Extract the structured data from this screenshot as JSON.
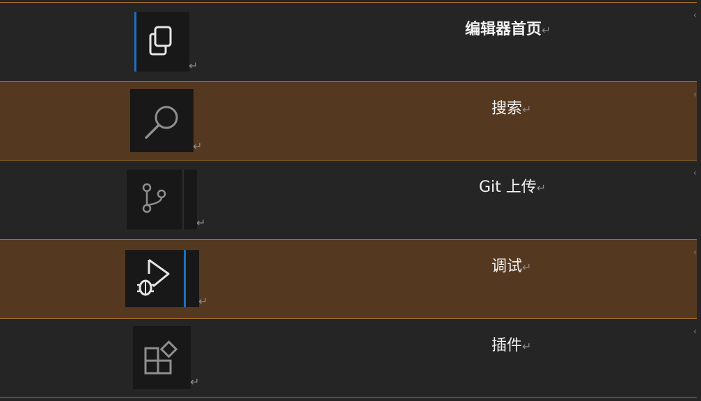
{
  "rows": [
    {
      "label": "编辑器首页",
      "icon": "copy-icon",
      "active": true
    },
    {
      "label": "搜索",
      "icon": "search-icon",
      "active": false
    },
    {
      "label": "Git 上传",
      "icon": "source-control-icon",
      "active": false
    },
    {
      "label": "调试",
      "icon": "debug-icon",
      "active": false
    },
    {
      "label": "插件",
      "icon": "extensions-icon",
      "active": false
    }
  ],
  "marks": {
    "return": "↵",
    "edge": "‹"
  },
  "colors": {
    "highlight_row": "#553820",
    "rule": "#a8712a",
    "accent": "#1f6fc2",
    "background": "#252525"
  }
}
